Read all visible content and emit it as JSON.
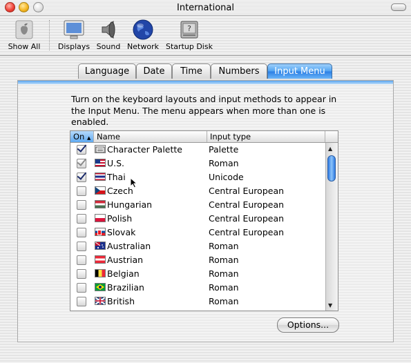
{
  "window": {
    "title": "International"
  },
  "toolbar": {
    "items": [
      {
        "label": "Show All",
        "icon": "apple-logo-icon"
      },
      {
        "label": "Displays",
        "icon": "display-monitor-icon"
      },
      {
        "label": "Sound",
        "icon": "speaker-icon"
      },
      {
        "label": "Network",
        "icon": "globe-icon"
      },
      {
        "label": "Startup Disk",
        "icon": "hard-disk-icon"
      }
    ]
  },
  "tabs": [
    {
      "label": "Language",
      "active": false
    },
    {
      "label": "Date",
      "active": false
    },
    {
      "label": "Time",
      "active": false
    },
    {
      "label": "Numbers",
      "active": false
    },
    {
      "label": "Input Menu",
      "active": true
    }
  ],
  "panel": {
    "description": "Turn on the keyboard layouts and input methods to appear in the Input Menu. The menu appears when more than one is enabled.",
    "table": {
      "headers": {
        "on": "On",
        "name": "Name",
        "type": "Input type"
      },
      "rows": [
        {
          "name": "Character Palette",
          "type": "Palette",
          "checked": true,
          "flag": "character-palette-icon"
        },
        {
          "name": "U.S.",
          "type": "Roman",
          "checked": true,
          "dimmed": true,
          "flag": "us-flag-icon"
        },
        {
          "name": "Thai",
          "type": "Unicode",
          "checked": true,
          "flag": "thai-flag-icon"
        },
        {
          "name": "Czech",
          "type": "Central European",
          "checked": false,
          "flag": "czech-flag-icon"
        },
        {
          "name": "Hungarian",
          "type": "Central European",
          "checked": false,
          "flag": "hungarian-flag-icon"
        },
        {
          "name": "Polish",
          "type": "Central European",
          "checked": false,
          "flag": "polish-flag-icon"
        },
        {
          "name": "Slovak",
          "type": "Central European",
          "checked": false,
          "flag": "slovak-flag-icon"
        },
        {
          "name": "Australian",
          "type": "Roman",
          "checked": false,
          "flag": "australian-flag-icon"
        },
        {
          "name": "Austrian",
          "type": "Roman",
          "checked": false,
          "flag": "austrian-flag-icon"
        },
        {
          "name": "Belgian",
          "type": "Roman",
          "checked": false,
          "flag": "belgian-flag-icon"
        },
        {
          "name": "Brazilian",
          "type": "Roman",
          "checked": false,
          "flag": "brazilian-flag-icon"
        },
        {
          "name": "British",
          "type": "Roman",
          "checked": false,
          "flag": "british-flag-icon"
        }
      ]
    },
    "options_label": "Options..."
  }
}
